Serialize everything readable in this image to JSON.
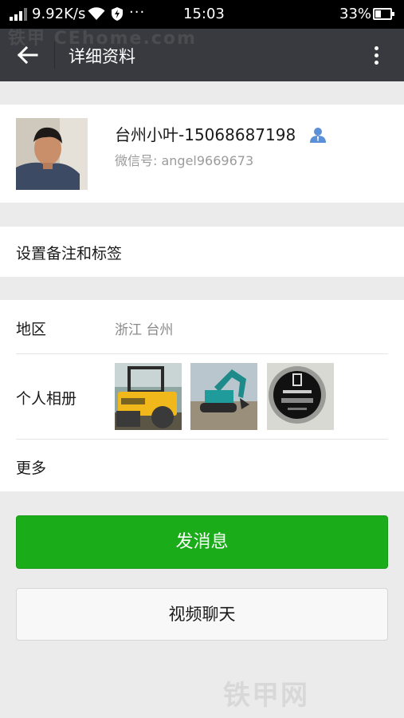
{
  "status_bar": {
    "net_speed": "9.92K/s",
    "more": "···",
    "time": "15:03",
    "battery": "33%",
    "icons": [
      "signal-icon",
      "wifi-icon",
      "shield-icon",
      "battery-icon"
    ]
  },
  "header": {
    "title": "详细资料",
    "icons": [
      "back-arrow-icon",
      "more-vertical-icon"
    ]
  },
  "watermark": {
    "top": "铁甲 CEhome.com",
    "bottom": "铁甲网"
  },
  "profile": {
    "name": "台州小叶-15068687198",
    "wechat_id": "微信号: angel9669673",
    "icons": [
      "contact-person-icon"
    ]
  },
  "remark": {
    "label": "设置备注和标签"
  },
  "info": {
    "region_label": "地区",
    "region_value": "浙江  台州",
    "album_label": "个人相册",
    "album_photos": [
      "road-roller-photo",
      "excavator-photo",
      "gauge-photo"
    ],
    "more_label": "更多"
  },
  "actions": {
    "message": "发消息",
    "video_call": "视频聊天"
  },
  "colors": {
    "header_bg": "#393a3f",
    "primary_green": "#1aad19",
    "page_bg": "#ebebeb",
    "contact_icon": "#5b8fd6"
  }
}
